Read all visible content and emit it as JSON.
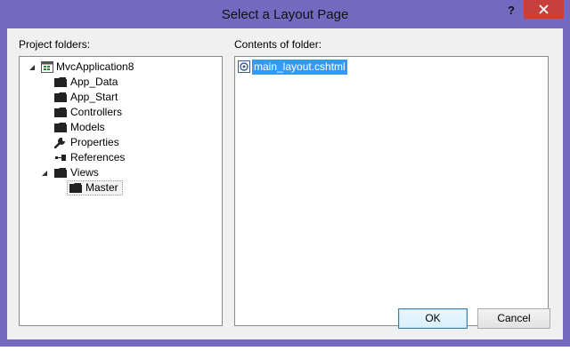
{
  "dialog": {
    "title": "Select a Layout Page",
    "help_glyph": "?",
    "accent_color": "#7369c0",
    "close_color": "#c7403c"
  },
  "project_folders": {
    "label": "Project folders:",
    "tree": [
      {
        "label": "MvcApplication8",
        "icon": "project-icon",
        "expanded": true,
        "level": 0
      },
      {
        "label": "App_Data",
        "icon": "folder-icon",
        "level": 1
      },
      {
        "label": "App_Start",
        "icon": "folder-icon",
        "level": 1
      },
      {
        "label": "Controllers",
        "icon": "folder-icon",
        "level": 1
      },
      {
        "label": "Models",
        "icon": "folder-icon",
        "level": 1
      },
      {
        "label": "Properties",
        "icon": "wrench-icon",
        "level": 1
      },
      {
        "label": "References",
        "icon": "references-icon",
        "level": 1
      },
      {
        "label": "Views",
        "icon": "folder-icon",
        "expanded": true,
        "level": 1
      },
      {
        "label": "Master",
        "icon": "folder-icon",
        "level": 2,
        "selected": true
      }
    ]
  },
  "contents": {
    "label": "Contents of folder:",
    "files": [
      {
        "label": "main_layout.cshtml",
        "icon": "razor-file-icon",
        "selected": true
      }
    ]
  },
  "buttons": {
    "ok": "OK",
    "cancel": "Cancel"
  }
}
